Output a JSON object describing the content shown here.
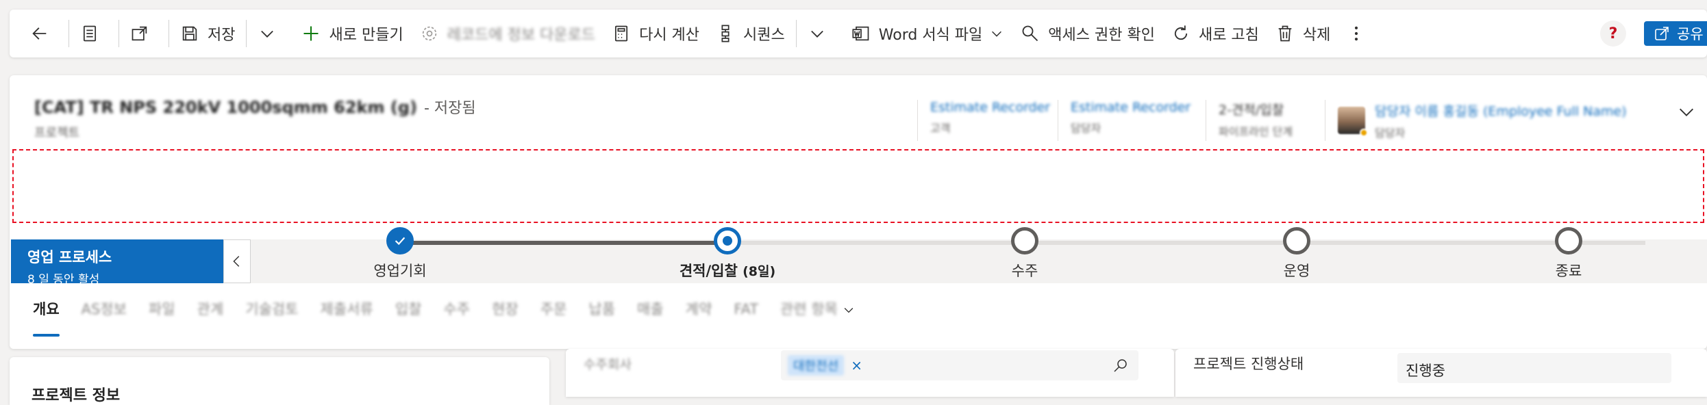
{
  "toolbar": {
    "save_label": "저장",
    "new_label": "새로 만들기",
    "disabled_label": "레코드에 정보 다운로드",
    "recalc_label": "다시 계산",
    "sequence_label": "시퀀스",
    "word_label": "Word 서식 파일",
    "access_label": "액세스 권한 확인",
    "refresh_label": "새로 고침",
    "delete_label": "삭제",
    "help_label": "?",
    "share_label": "공유"
  },
  "record": {
    "title": "[CAT] TR NPS 220kV 1000sqmm 62km (g)",
    "saved_status": "- 저장됨",
    "entity_name": "프로젝트"
  },
  "header_fields": [
    {
      "value": "Estimate Recorder",
      "label": "고객"
    },
    {
      "value": "Estimate Recorder",
      "label": "담당자"
    },
    {
      "value": "2-견적/입찰",
      "label": "파이프라인 단계"
    }
  ],
  "owner": {
    "name": "담당자 이름 홍길동 (Employee Full Name)",
    "label": "담당자"
  },
  "bpf": {
    "title": "영업 프로세스",
    "subtitle": "8 일 동안 활성",
    "stages": [
      {
        "label": "영업기회",
        "state": "done"
      },
      {
        "label": "견적/입찰",
        "duration": "(8일)",
        "state": "current"
      },
      {
        "label": "수주",
        "state": "pending"
      },
      {
        "label": "운영",
        "state": "pending"
      },
      {
        "label": "종료",
        "state": "pending"
      }
    ]
  },
  "tabs": [
    "개요",
    "AS정보",
    "파일",
    "관계",
    "기술검토",
    "제출서류",
    "입찰",
    "수주",
    "현장",
    "주문",
    "납품",
    "매출",
    "계약",
    "FAT",
    "관련 항목"
  ],
  "lower": {
    "section_title": "프로젝트 정보",
    "lookup_label": "수주회사",
    "lookup_chip": "대한전선",
    "lookup_clear": "×",
    "status_label": "프로젝트 진행상태",
    "status_value": "진행중"
  },
  "colors": {
    "accent": "#0f6cbd",
    "notification_border": "#e81123",
    "help": "#c50f1f"
  }
}
